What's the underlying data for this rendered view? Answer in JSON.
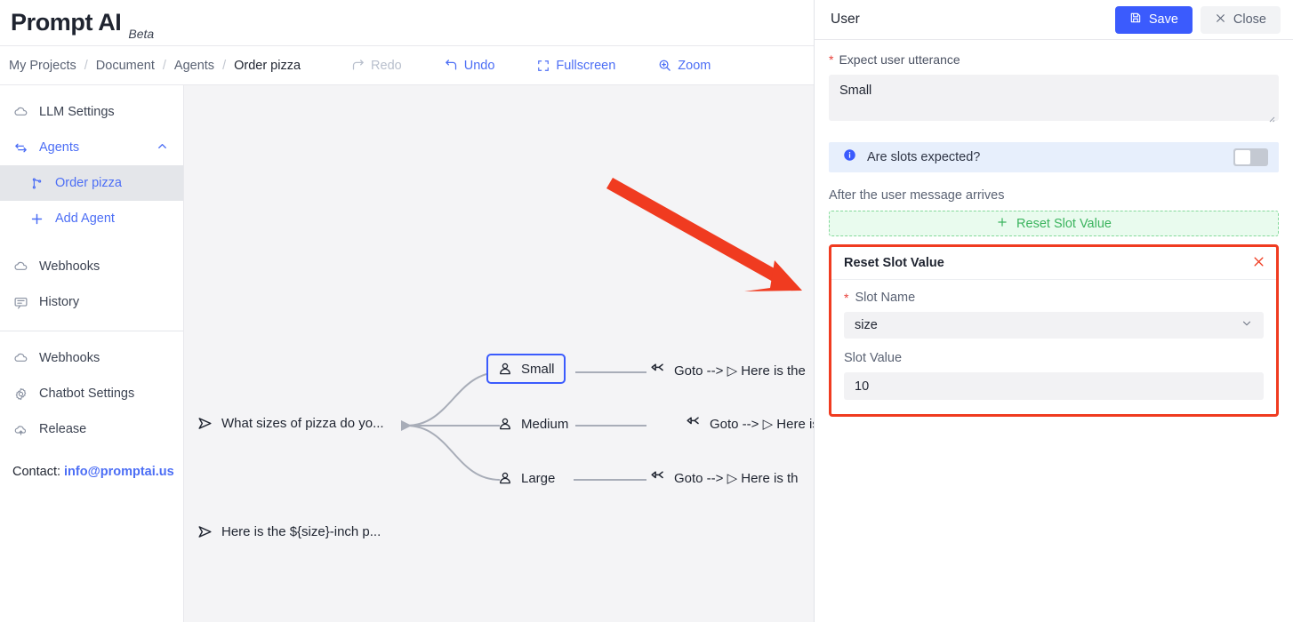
{
  "brand": {
    "title": "Prompt AI",
    "beta": "Beta"
  },
  "breadcrumb": {
    "items": [
      "My Projects",
      "Document",
      "Agents",
      "Order pizza"
    ],
    "separator": "/"
  },
  "toolbar": {
    "redo": "Redo",
    "undo": "Undo",
    "fullscreen": "Fullscreen",
    "zoom": "Zoom"
  },
  "sidebar": {
    "llm_settings": "LLM Settings",
    "agents": "Agents",
    "order_pizza": "Order pizza",
    "add_agent": "Add Agent",
    "webhooks": "Webhooks",
    "history": "History",
    "webhooks2": "Webhooks",
    "chatbot_settings": "Chatbot Settings",
    "release": "Release",
    "contact_label": "Contact:",
    "contact_email": "info@promptai.us"
  },
  "canvas": {
    "prompt_node": "What sizes of pizza do yo...",
    "option_small": "Small",
    "option_medium": "Medium",
    "option_large": "Large",
    "goto_small": "Goto --> ▷ Here is the",
    "goto_medium": "Goto --> ▷ Here is",
    "goto_large": "Goto --> ▷ Here is th",
    "answer_node": "Here is the ${size}-inch p..."
  },
  "panel": {
    "title": "User",
    "save_label": "Save",
    "close_label": "Close",
    "utterance_label": "Expect user utterance",
    "utterance_value": "Small",
    "slots_question": "Are slots expected?",
    "after_message_label": "After the user message arrives",
    "add_reset_slot_label": "Reset Slot Value",
    "card": {
      "title": "Reset Slot Value",
      "slot_name_label": "Slot Name",
      "slot_name_value": "size",
      "slot_value_label": "Slot Value",
      "slot_value_value": "10"
    }
  },
  "colors": {
    "accent_blue": "#4c6ef5",
    "save_blue": "#3b5bfd",
    "annotation_red": "#f03b20",
    "green": "#3bb45e",
    "canvas_bg": "#f4f4f6"
  }
}
